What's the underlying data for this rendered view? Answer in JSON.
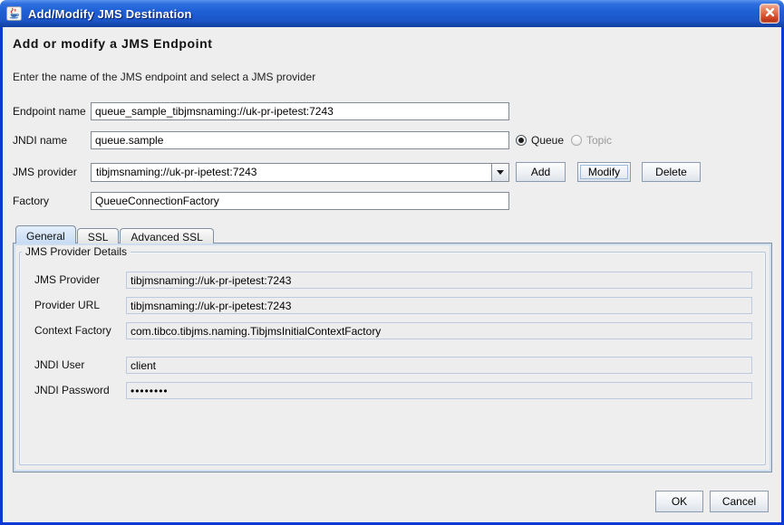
{
  "window": {
    "title": "Add/Modify JMS Destination"
  },
  "header": {
    "title": "Add or modify a JMS Endpoint",
    "subtitle": "Enter the name of the JMS endpoint and select a JMS provider"
  },
  "form": {
    "endpoint_name": {
      "label": "Endpoint name",
      "value": "queue_sample_tibjmsnaming://uk-pr-ipetest:7243"
    },
    "jndi_name": {
      "label": "JNDI name",
      "value": "queue.sample"
    },
    "destination_type": {
      "options": [
        {
          "label": "Queue",
          "selected": true,
          "enabled": true
        },
        {
          "label": "Topic",
          "selected": false,
          "enabled": false
        }
      ]
    },
    "jms_provider": {
      "label": "JMS provider",
      "value": "tibjmsnaming://uk-pr-ipetest:7243"
    },
    "provider_buttons": {
      "add": "Add",
      "modify": "Modify",
      "delete": "Delete"
    },
    "factory": {
      "label": "Factory",
      "value": "QueueConnectionFactory"
    }
  },
  "tabs": [
    {
      "label": "General",
      "selected": true
    },
    {
      "label": "SSL",
      "selected": false
    },
    {
      "label": "Advanced SSL",
      "selected": false
    }
  ],
  "provider_details": {
    "group_title": "JMS Provider Details",
    "fields": [
      {
        "label": "JMS Provider",
        "value": "tibjmsnaming://uk-pr-ipetest:7243"
      },
      {
        "label": "Provider URL",
        "value": "tibjmsnaming://uk-pr-ipetest:7243"
      },
      {
        "label": "Context Factory",
        "value": "com.tibco.tibjms.naming.TibjmsInitialContextFactory"
      },
      {
        "label": "JNDI User",
        "value": "client"
      },
      {
        "label": "JNDI Password",
        "value": "••••••••",
        "masked": true
      }
    ]
  },
  "footer": {
    "ok": "OK",
    "cancel": "Cancel"
  },
  "colors": {
    "titlebar_blue": "#1f5fd6",
    "window_border_blue": "#0a3ad5",
    "close_button_red": "#d34a28",
    "selected_tab_blue": "#c6dbf3",
    "panel_gray": "#eeeeee"
  }
}
